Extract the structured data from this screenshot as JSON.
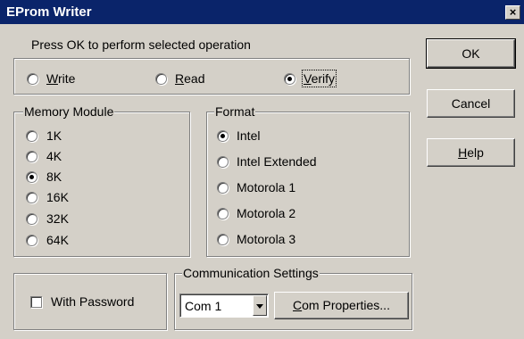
{
  "window": {
    "title": "EProm Writer",
    "close_glyph": "×"
  },
  "instructions": "Press OK to perform selected operation",
  "operation": {
    "options": [
      {
        "label_u": "W",
        "label_rest": "rite",
        "selected": false
      },
      {
        "label_u": "R",
        "label_rest": "ead",
        "selected": false
      },
      {
        "label_u": "V",
        "label_rest": "erify",
        "selected": true
      }
    ]
  },
  "memory_module": {
    "label": "Memory Module",
    "options": [
      {
        "label": "1K",
        "selected": false
      },
      {
        "label": "4K",
        "selected": false
      },
      {
        "label": "8K",
        "selected": true
      },
      {
        "label": "16K",
        "selected": false
      },
      {
        "label": "32K",
        "selected": false
      },
      {
        "label": "64K",
        "selected": false
      }
    ]
  },
  "format": {
    "label": "Format",
    "options": [
      {
        "label": "Intel",
        "selected": true
      },
      {
        "label": "Intel Extended",
        "selected": false
      },
      {
        "label": "Motorola 1",
        "selected": false
      },
      {
        "label": "Motorola 2",
        "selected": false
      },
      {
        "label": "Motorola 3",
        "selected": false
      }
    ]
  },
  "password": {
    "label": "With Password",
    "checked": false
  },
  "communication": {
    "label": "Communication Settings",
    "port_value": "Com 1",
    "properties_u": "C",
    "properties_rest": "om Properties..."
  },
  "buttons": {
    "ok": "OK",
    "cancel": "Cancel",
    "help_u": "H",
    "help_rest": "elp"
  }
}
